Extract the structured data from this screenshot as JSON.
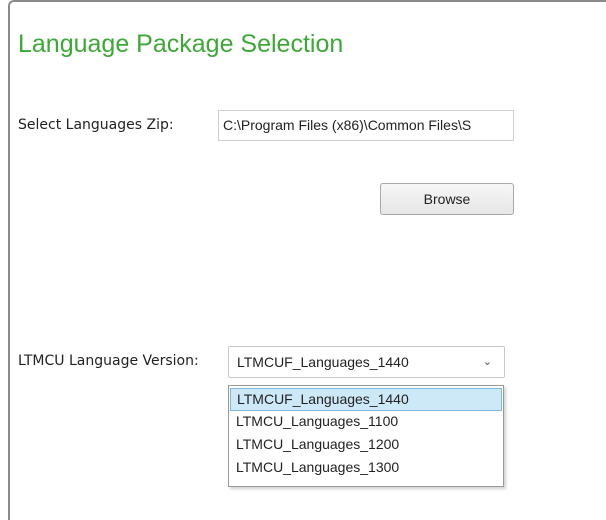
{
  "title": "Language Package Selection",
  "zip": {
    "label": "Select Languages Zip:",
    "value": "C:\\Program Files (x86)\\Common Files\\S"
  },
  "browse_label": "Browse",
  "version": {
    "label": "LTMCU Language Version:",
    "selected": "LTMCUF_Languages_1440",
    "options": [
      "LTMCUF_Languages_1440",
      "LTMCU_Languages_1100",
      "LTMCU_Languages_1200",
      "LTMCU_Languages_1300"
    ]
  },
  "icons": {
    "dropdown": "chevron-down-icon"
  },
  "colors": {
    "title": "#3aaa35",
    "selection": "#cde8f7"
  }
}
